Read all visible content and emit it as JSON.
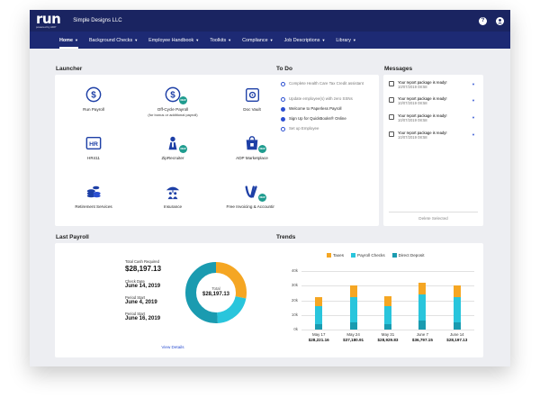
{
  "app": {
    "logo": "run",
    "logo_sub": "powered by ADP",
    "company": "Simple Designs LLC"
  },
  "top_icons": [
    "?",
    "person"
  ],
  "nav": [
    {
      "label": "Home",
      "active": true
    },
    {
      "label": "Background Checks",
      "active": false
    },
    {
      "label": "Employee Handbook",
      "active": false
    },
    {
      "label": "Toolkits",
      "active": false
    },
    {
      "label": "Compliance",
      "active": false
    },
    {
      "label": "Job Descriptions",
      "active": false
    },
    {
      "label": "Library",
      "active": false
    }
  ],
  "launcher": {
    "title": "Launcher",
    "items": [
      {
        "label": "Run Payroll",
        "sub": "",
        "icon": "dollar-icon",
        "new": false
      },
      {
        "label": "Off-Cycle Payroll",
        "sub": "(for bonus or additional payroll)",
        "icon": "dollar-icon",
        "new": true
      },
      {
        "label": "Doc Vault",
        "sub": "",
        "icon": "vault-icon",
        "new": false
      },
      {
        "label": "HR411",
        "sub": "",
        "icon": "hr-icon",
        "new": false
      },
      {
        "label": "ZipRecruiter",
        "sub": "",
        "icon": "recruiter-icon",
        "new": true
      },
      {
        "label": "ADP Marketplace",
        "sub": "",
        "icon": "marketplace-icon",
        "new": true
      },
      {
        "label": "Retirement Services",
        "sub": "",
        "icon": "coins-icon",
        "new": false
      },
      {
        "label": "Insurance",
        "sub": "",
        "icon": "insurance-icon",
        "new": false
      },
      {
        "label": "Free Invoicing & Accounting",
        "sub": "",
        "icon": "invoicing-icon",
        "new": true
      }
    ],
    "new_badge": "NEW"
  },
  "todo": {
    "title": "To Do",
    "items": [
      {
        "text": "Complete Health Care Tax Credit assistant",
        "done": false
      },
      {
        "text": "Update employee(s) with zero SSNs",
        "done": false
      },
      {
        "text": "Welcome to Paperless Payroll",
        "done": true
      },
      {
        "text": "Sign Up for QuickBooks® Online",
        "done": true
      },
      {
        "text": "Set up Employee",
        "done": false
      }
    ]
  },
  "messages": {
    "title": "Messages",
    "items": [
      {
        "text": "Your report package is ready!",
        "date": "10/07/2019 08:58"
      },
      {
        "text": "Your report package is ready!",
        "date": "10/07/2019 08:58"
      },
      {
        "text": "Your report package is ready!",
        "date": "10/07/2019 08:58"
      },
      {
        "text": "Your report package is ready!",
        "date": "10/07/2019 08:58"
      }
    ],
    "delete_label": "Delete Selected"
  },
  "last_payroll": {
    "title": "Last Payroll",
    "total_cash_label": "Total Cash Required",
    "total_cash_value": "$28,197.13",
    "check_date_label": "Check Date",
    "check_date_value": "June 14, 2019",
    "period_start_label": "Period Start",
    "period_start_value": "June 4, 2019",
    "period_start2_label": "Period Start",
    "period_start2_value": "June 16, 2019",
    "donut_label": "Total",
    "donut_value": "$28,197.13",
    "donut_slices": [
      {
        "value": 28,
        "color": "#f5a623"
      },
      {
        "value": 21,
        "color": "#29c5dc"
      },
      {
        "value": 51,
        "color": "#1a9bb0"
      }
    ],
    "view_details": "View Details"
  },
  "trends": {
    "title": "Trends",
    "legend": [
      {
        "name": "Taxes",
        "color": "#f5a623"
      },
      {
        "name": "Payroll Checks",
        "color": "#29c5dc"
      },
      {
        "name": "Direct Deposit",
        "color": "#1a9bb0"
      }
    ],
    "yticks": [
      "40k",
      "30k",
      "20k",
      "10k",
      "0k"
    ],
    "ymax": 40,
    "periods": [
      {
        "label": "May 17",
        "value": "$28,221.16",
        "segments": [
          6,
          12,
          4
        ]
      },
      {
        "label": "May 24",
        "value": "$37,180.91",
        "segments": [
          8,
          17,
          5
        ]
      },
      {
        "label": "May 31",
        "value": "$28,929.83",
        "segments": [
          7,
          12,
          4
        ]
      },
      {
        "label": "June 7",
        "value": "$36,797.15",
        "segments": [
          8,
          18,
          6
        ]
      },
      {
        "label": "June 14",
        "value": "$28,197.13",
        "segments": [
          8,
          17,
          5
        ]
      }
    ]
  },
  "colors": {
    "nav": "#1a2461",
    "accent": "#2b4fd1",
    "taxes": "#f5a623",
    "checks": "#29c5dc",
    "deposit": "#1a9bb0"
  }
}
